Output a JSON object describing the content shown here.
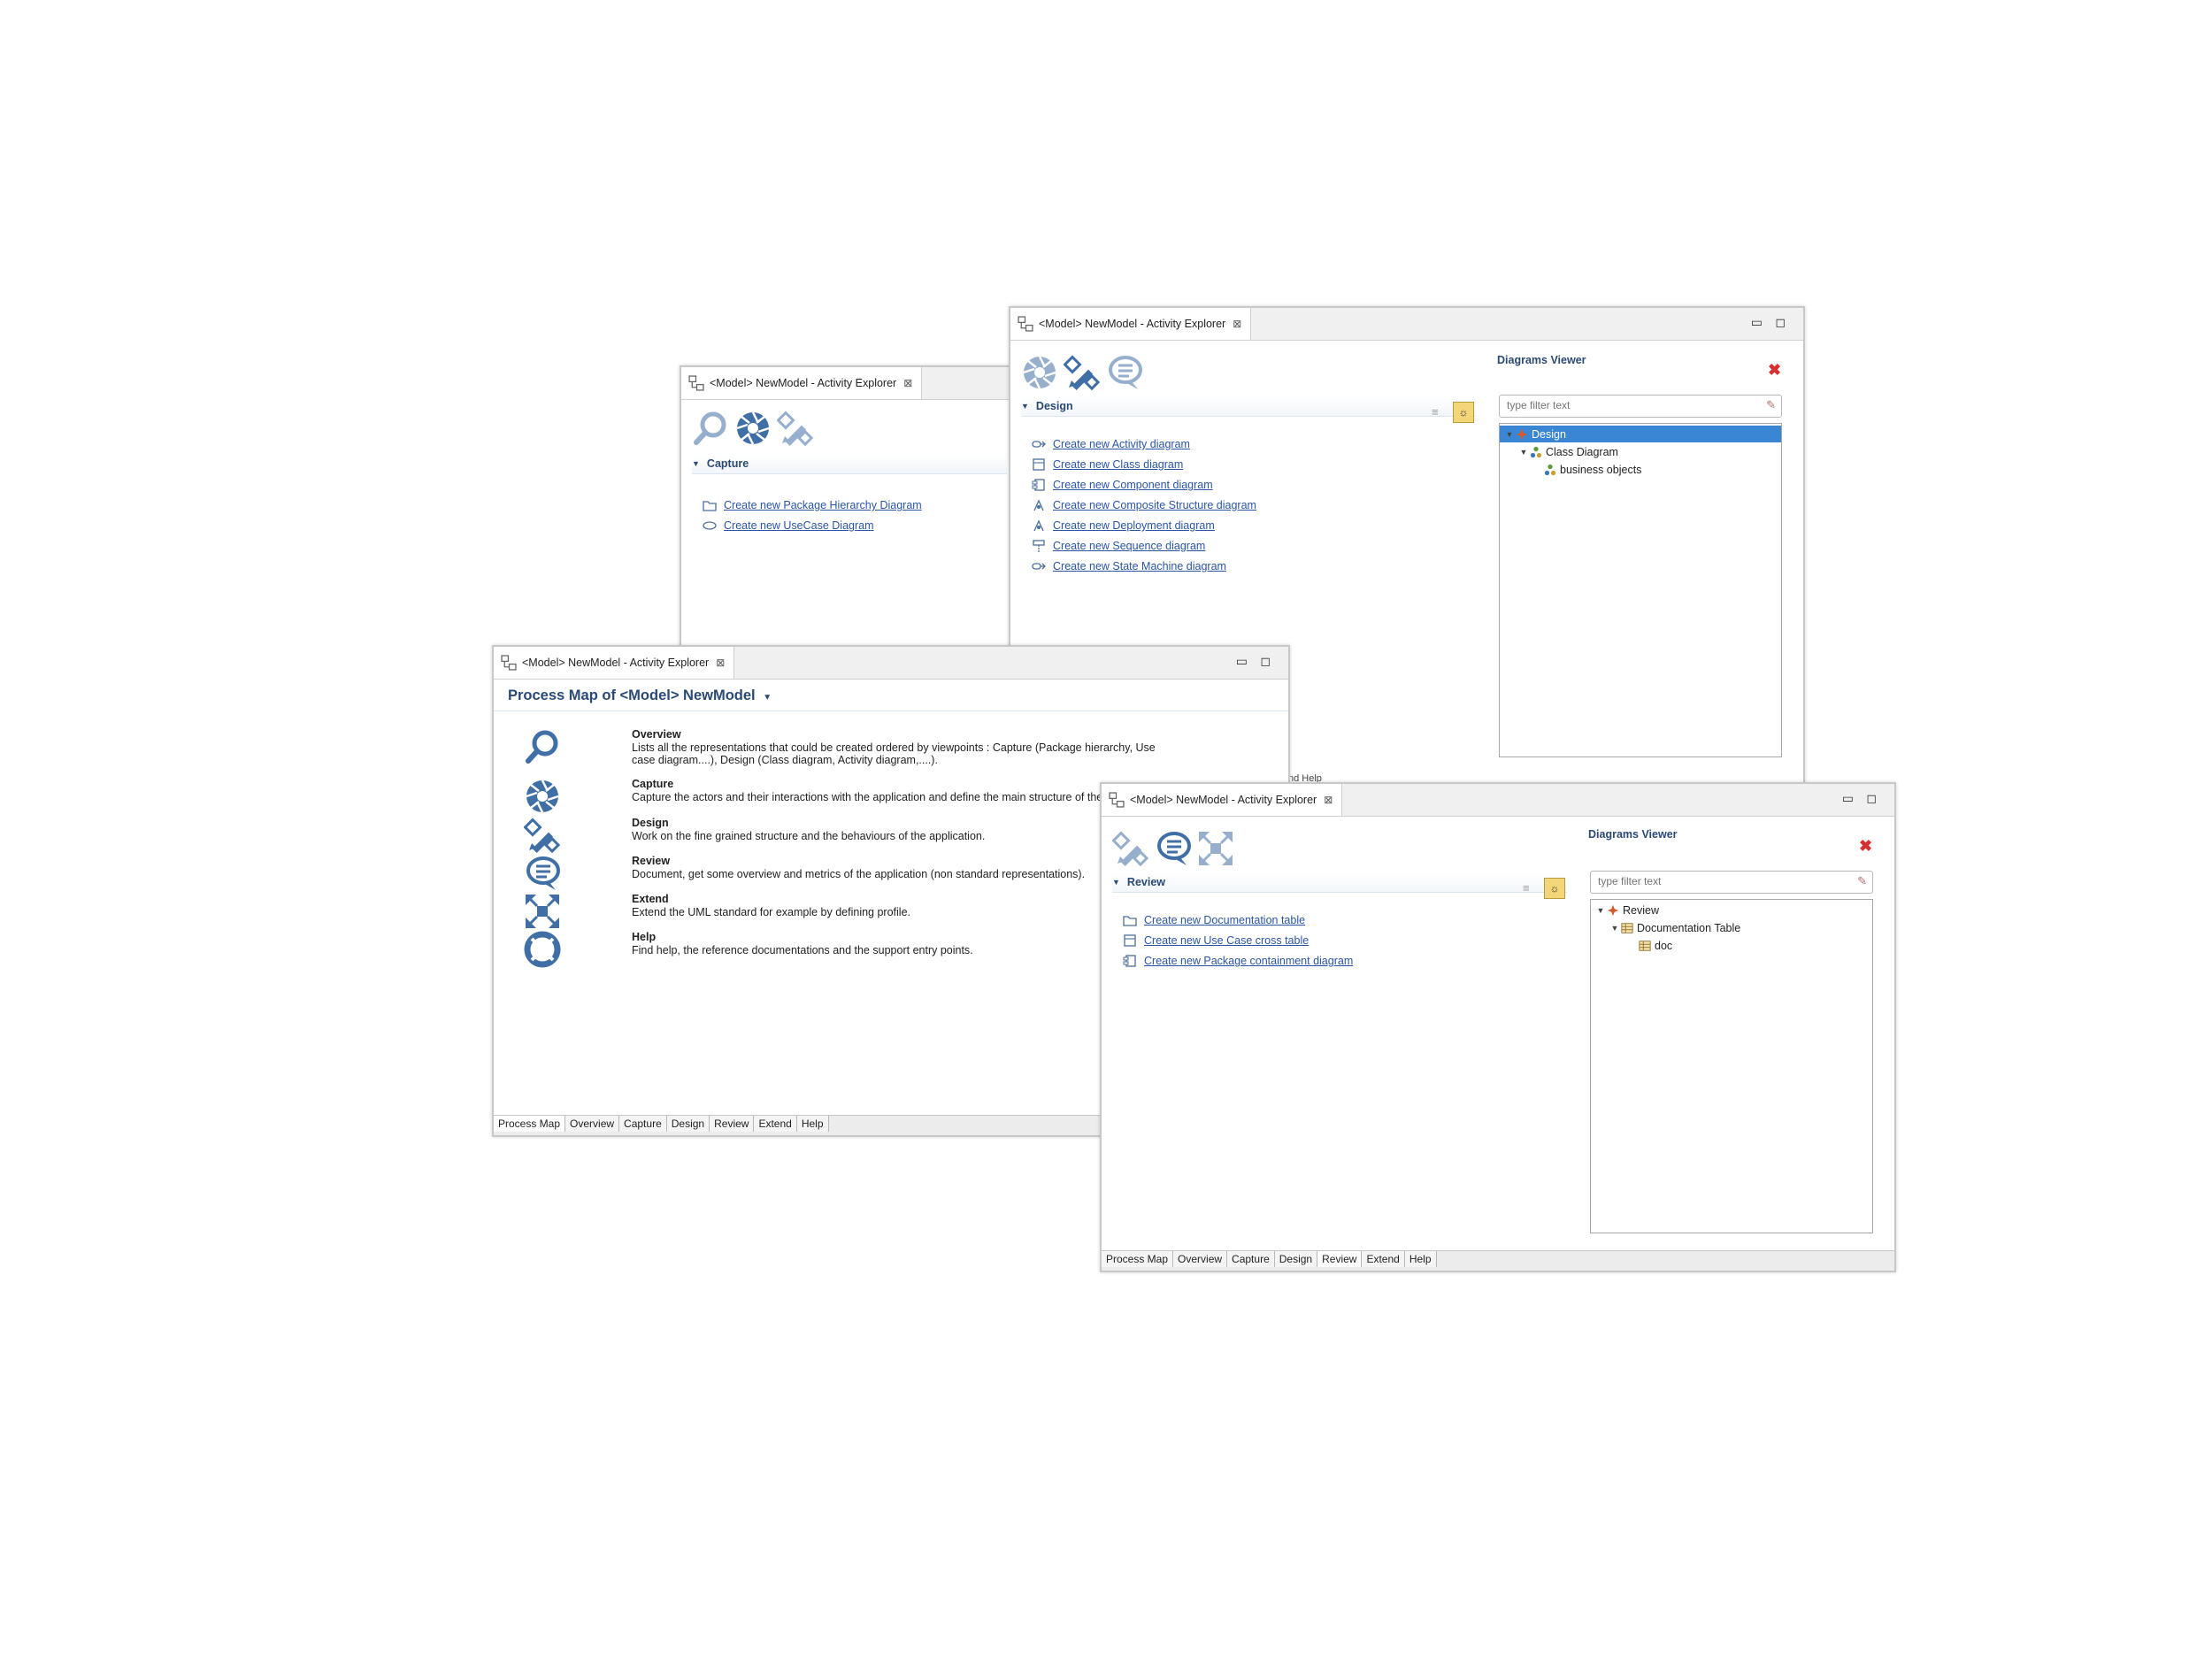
{
  "capture_window": {
    "tab_title": "<Model> NewModel - Activity Explorer",
    "section": "Capture",
    "links": [
      {
        "label": "Create new Package Hierarchy Diagram",
        "icon": "folder-icon"
      },
      {
        "label": "Create new UseCase Diagram",
        "icon": "usecase-icon"
      }
    ]
  },
  "design_window": {
    "tab_title": "<Model> NewModel - Activity Explorer",
    "section": "Design",
    "links": [
      {
        "label": "Create new Activity diagram",
        "icon": "activity-icon"
      },
      {
        "label": "Create new Class diagram",
        "icon": "class-icon"
      },
      {
        "label": "Create new Component diagram",
        "icon": "component-icon"
      },
      {
        "label": "Create new Composite Structure diagram",
        "icon": "composite-icon"
      },
      {
        "label": "Create new Deployment diagram",
        "icon": "deployment-icon"
      },
      {
        "label": "Create new Sequence diagram",
        "icon": "sequence-icon"
      },
      {
        "label": "Create new State Machine diagram",
        "icon": "statemachine-icon"
      }
    ],
    "viewer": {
      "title": "Diagrams Viewer",
      "filter_placeholder": "type filter text",
      "tree": [
        {
          "label": "Design",
          "level": 0,
          "selected": true
        },
        {
          "label": "Class Diagram",
          "level": 1,
          "selected": false
        },
        {
          "label": "business objects",
          "level": 2,
          "selected": false
        }
      ]
    },
    "bottom_fragment": "nd Help"
  },
  "process_window": {
    "tab_title": "<Model> NewModel - Activity Explorer",
    "title": "Process Map of <Model> NewModel",
    "items": [
      {
        "name": "Overview",
        "desc": "Lists all the representations that could be created ordered by viewpoints : Capture (Package hierarchy, Use case diagram....), Design (Class diagram, Activity diagram,....).",
        "icon": "magnifier-icon"
      },
      {
        "name": "Capture",
        "desc": "Capture the actors and their interactions with the application and define the main structure of the application.",
        "icon": "aperture-icon"
      },
      {
        "name": "Design",
        "desc": "Work on the fine grained structure and the behaviours of the application.",
        "icon": "pencil-ruler-icon"
      },
      {
        "name": "Review",
        "desc": "Document, get some overview and metrics of the application (non standard representations).",
        "icon": "speech-bubble-icon"
      },
      {
        "name": "Extend",
        "desc": "Extend the UML standard for example by defining profile.",
        "icon": "expand-arrows-icon"
      },
      {
        "name": "Help",
        "desc": "Find help, the reference documentations and the support entry points.",
        "icon": "lifebuoy-icon"
      }
    ],
    "bottom_tabs": [
      "Process Map",
      "Overview",
      "Capture",
      "Design",
      "Review",
      "Extend",
      "Help"
    ],
    "active_tab": "Process Map"
  },
  "review_window": {
    "tab_title": "<Model> NewModel - Activity Explorer",
    "section": "Review",
    "links": [
      {
        "label": "Create new Documentation table",
        "icon": "folder-icon"
      },
      {
        "label": "Create new Use Case cross table",
        "icon": "table-icon"
      },
      {
        "label": "Create new Package containment diagram",
        "icon": "package-icon"
      }
    ],
    "viewer": {
      "title": "Diagrams Viewer",
      "filter_placeholder": "type filter text",
      "tree": [
        {
          "label": "Review",
          "level": 0,
          "selected": false
        },
        {
          "label": "Documentation Table",
          "level": 1,
          "selected": false
        },
        {
          "label": "doc",
          "level": 2,
          "selected": false
        }
      ]
    },
    "bottom_tabs": [
      "Process Map",
      "Overview",
      "Capture",
      "Design",
      "Review",
      "Extend",
      "Help"
    ],
    "active_tab": "Review"
  },
  "colors": {
    "accent": "#2a4a75",
    "link": "#2a55a6",
    "selection": "#3b86d4",
    "icon_blue": "#3f6fa5",
    "close_red": "#d83030"
  }
}
